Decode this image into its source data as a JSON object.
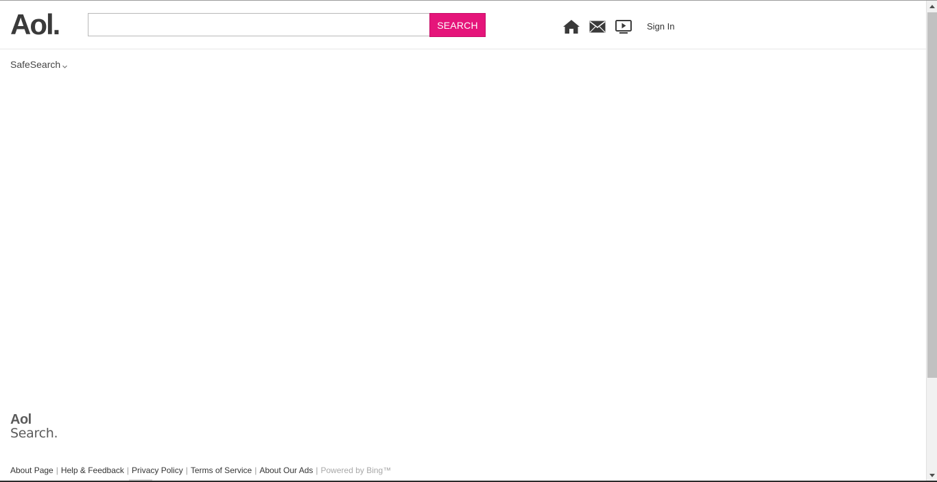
{
  "header": {
    "logo": "Aol.",
    "search": {
      "value": "",
      "placeholder": "",
      "button_label": "SEARCH"
    },
    "nav_icons": [
      {
        "name": "home-icon"
      },
      {
        "name": "mail-icon"
      },
      {
        "name": "video-icon"
      }
    ],
    "sign_in_label": "Sign In"
  },
  "filters": {
    "safesearch_label": "SafeSearch"
  },
  "footer": {
    "logo_line1": "Aol",
    "logo_line2": "Search.",
    "links": [
      {
        "label": "About Page"
      },
      {
        "label": "Help & Feedback"
      },
      {
        "label": "Privacy Policy"
      },
      {
        "label": "Terms of Service"
      },
      {
        "label": "About Our Ads"
      }
    ],
    "powered_by": "Powered by Bing™"
  },
  "colors": {
    "accent": "#e5157a",
    "text": "#333333",
    "logo": "#3a3a3a",
    "muted": "#a8a8a8"
  }
}
